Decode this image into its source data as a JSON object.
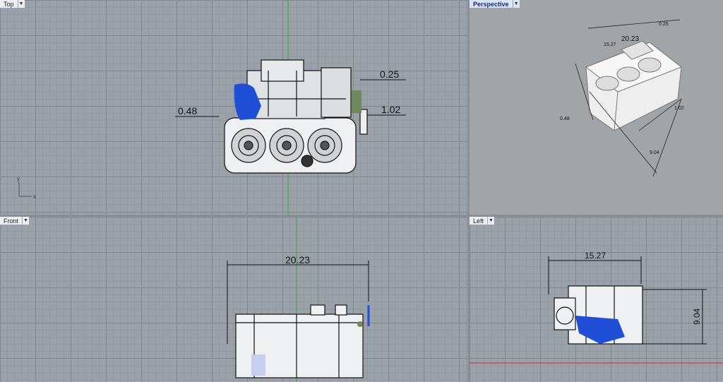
{
  "viewports": {
    "top": {
      "label": "Top",
      "dims": {
        "a": "0.25",
        "b": "0.48",
        "c": "1.02"
      },
      "axis_x": "x",
      "axis_y": "y"
    },
    "perspective": {
      "label": "Perspective",
      "dims": {
        "a": "20.23",
        "b": "0.25",
        "c": "0.48",
        "d": "1.02",
        "e": "9.04",
        "f": "15.27"
      }
    },
    "front": {
      "label": "Front",
      "dims": {
        "width": "20.23"
      }
    },
    "left": {
      "label": "Left",
      "dims": {
        "width": "15.27",
        "height": "9.04"
      }
    }
  },
  "icons": {
    "dropdown": "chevron-down-icon"
  },
  "colors": {
    "active_tab": "#d8e4f7",
    "grid_bg": "#9aa1a9",
    "blue_part": "#1f4fd6",
    "green_axis": "#2fae3a",
    "red_axis": "#c23030"
  }
}
